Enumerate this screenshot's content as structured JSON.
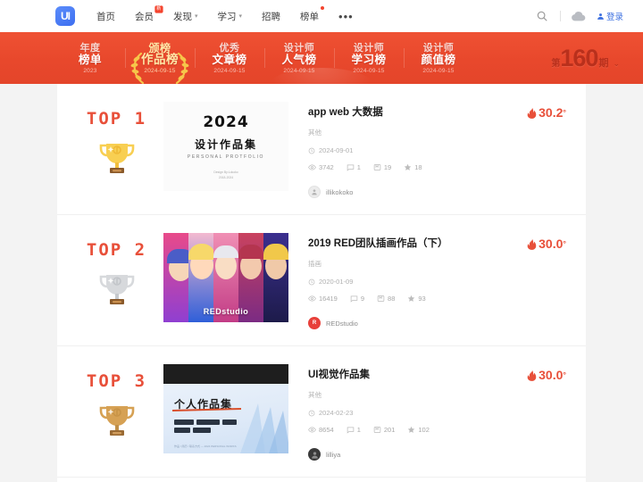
{
  "nav": {
    "logo_text": "UI",
    "items": [
      {
        "label": "首页",
        "dropdown": false,
        "badge": null
      },
      {
        "label": "会员",
        "dropdown": false,
        "badge": "新"
      },
      {
        "label": "发现",
        "dropdown": true,
        "badge": null
      },
      {
        "label": "学习",
        "dropdown": true,
        "badge": null
      },
      {
        "label": "招聘",
        "dropdown": false,
        "badge": null
      },
      {
        "label": "榜单",
        "dropdown": false,
        "badge": "dot"
      }
    ],
    "more_label": "•••",
    "search_icon": "search-icon",
    "upload_icon": "cloud-upload-icon",
    "login_label": "登录"
  },
  "band": {
    "tabs": [
      {
        "line1": "年度",
        "line2": "榜单",
        "date": "2023",
        "active": false
      },
      {
        "line1": "颁榜",
        "line2": "作品榜",
        "date": "2024-09-15",
        "active": true
      },
      {
        "line1": "优秀",
        "line2": "文章榜",
        "date": "2024-09-15",
        "active": false
      },
      {
        "line1": "设计师",
        "line2": "人气榜",
        "date": "2024-09-15",
        "active": false
      },
      {
        "line1": "设计师",
        "line2": "学习榜",
        "date": "2024-09-15",
        "active": false
      },
      {
        "line1": "设计师",
        "line2": "颜值榜",
        "date": "2024-09-15",
        "active": false
      }
    ],
    "issue_prefix": "第",
    "issue_number": "160",
    "issue_suffix": "期",
    "issue_chevron": "⌄"
  },
  "rows": [
    {
      "rank_label": "TOP 1",
      "trophy": "gold-trophy-icon",
      "thumb": {
        "year": "2024",
        "cn_title": "设计作品集",
        "en_title": "PERSONAL PROTFOLIO",
        "small_line1": "Design By:Lokoko",
        "small_line2": "2018-2024"
      },
      "title": "app web 大数据",
      "category": "其他",
      "date": "2024-09-01",
      "heat": "30.2",
      "degree": "°",
      "views": "3742",
      "comments": "1",
      "collects": "19",
      "likes": "18",
      "author": "illikokoko"
    },
    {
      "rank_label": "TOP 2",
      "trophy": "silver-trophy-icon",
      "thumb": {
        "watermark": "REDstudio"
      },
      "title": "2019 RED团队插画作品（下）",
      "category": "插画",
      "date": "2020-01-09",
      "heat": "30.0",
      "degree": "°",
      "views": "16419",
      "comments": "9",
      "collects": "88",
      "likes": "93",
      "author": "REDstudio"
    },
    {
      "rank_label": "TOP 3",
      "trophy": "bronze-trophy-icon",
      "thumb": {
        "cn_title": "个人作品集",
        "footer": "作品 / 简历 / 联系方式 — 2024 PERSONAL WORKS"
      },
      "title": "UI视觉作品集",
      "category": "其他",
      "date": "2024-02-23",
      "heat": "30.0",
      "degree": "°",
      "views": "8654",
      "comments": "1",
      "collects": "201",
      "likes": "102",
      "author": "lilliya"
    }
  ],
  "colors": {
    "brand_red": "#e8503a",
    "band_red": "#e8482c",
    "logo_blue": "#3d6ef0",
    "issue_dark_red": "#b9301c"
  }
}
